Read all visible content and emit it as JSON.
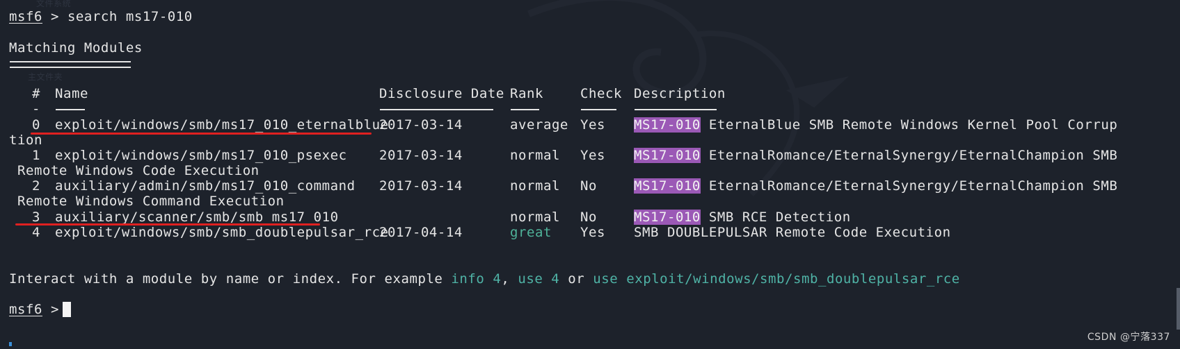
{
  "prompt": {
    "word": "msf6",
    "sep": " > ",
    "command": "search ms17-010"
  },
  "heading": "Matching Modules",
  "table": {
    "headers": {
      "index": "#",
      "name": "Name",
      "date": "Disclosure Date",
      "rank": "Rank",
      "check": "Check",
      "description": "Description"
    },
    "index_dash": "-",
    "rows": [
      {
        "idx": "0",
        "name": "exploit/windows/smb/ms17_010_eternalblue",
        "date": "2017-03-14",
        "rank": "average",
        "check": "Yes",
        "tag": "MS17-010",
        "desc": " EternalBlue SMB Remote Windows Kernel Pool Corrup",
        "wrap": "tion"
      },
      {
        "idx": "1",
        "name": "exploit/windows/smb/ms17_010_psexec",
        "date": "2017-03-14",
        "rank": "normal",
        "check": "Yes",
        "tag": "MS17-010",
        "desc": " EternalRomance/EternalSynergy/EternalChampion SMB",
        "wrap": " Remote Windows Code Execution"
      },
      {
        "idx": "2",
        "name": "auxiliary/admin/smb/ms17_010_command",
        "date": "2017-03-14",
        "rank": "normal",
        "check": "No",
        "tag": "MS17-010",
        "desc": " EternalRomance/EternalSynergy/EternalChampion SMB",
        "wrap": " Remote Windows Command Execution"
      },
      {
        "idx": "3",
        "name": "auxiliary/scanner/smb/smb_ms17_010",
        "date": "",
        "rank": "normal",
        "check": "No",
        "tag": "MS17-010",
        "desc": " SMB RCE Detection",
        "wrap": ""
      },
      {
        "idx": "4",
        "name": "exploit/windows/smb/smb_doublepulsar_rce",
        "date": "2017-04-14",
        "rank": "great",
        "check": "Yes",
        "tag": "",
        "desc": "SMB DOUBLEPULSAR Remote Code Execution",
        "wrap": ""
      }
    ]
  },
  "interact": {
    "text1": "Interact with a module by name or index. For example ",
    "link1": "info 4",
    "text2": ", ",
    "link2": "use 4",
    "text3": " or ",
    "link3": "use exploit/windows/smb/smb_doublepulsar_rce"
  },
  "prompt2": {
    "word": "msf6",
    "sep": " > "
  },
  "watermark": "CSDN @宁落337",
  "faint": {
    "a": "文件系统",
    "b": "主文件夹"
  },
  "colors": {
    "background": "#1d222b",
    "tag": "#9b59b6",
    "green": "#4fb39a",
    "annotation": "#e02020"
  }
}
